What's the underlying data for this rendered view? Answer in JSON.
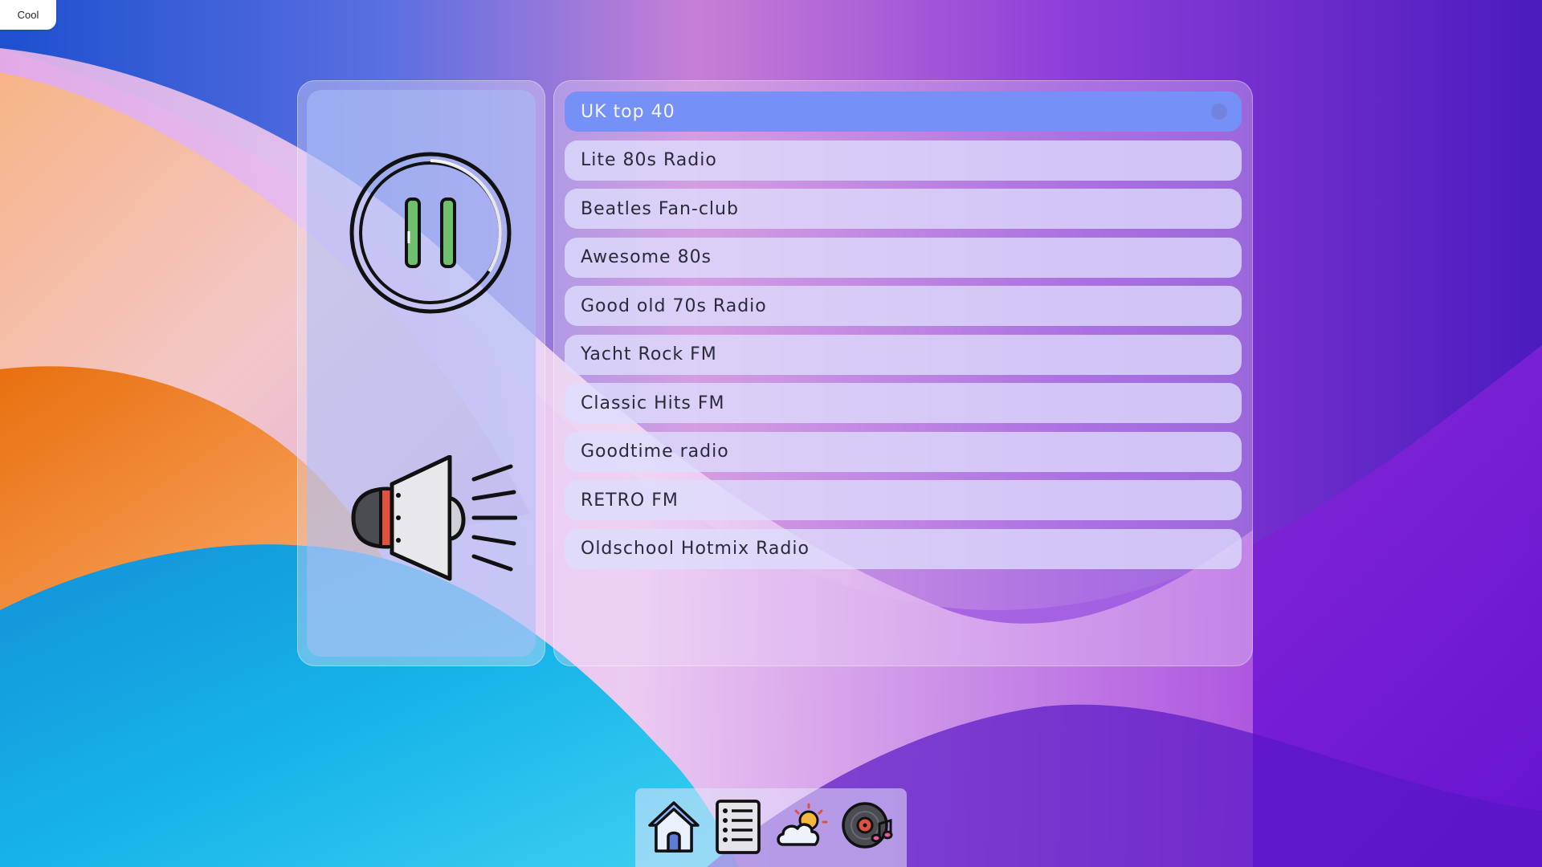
{
  "corner_tab": {
    "label": "Cool"
  },
  "player": {
    "state": "playing",
    "play_pause_icon": "pause-icon",
    "volume_icon": "speaker-icon"
  },
  "stations": {
    "selected_index": 0,
    "items": [
      {
        "label": "UK top 40"
      },
      {
        "label": "Lite 80s Radio"
      },
      {
        "label": "Beatles Fan-club"
      },
      {
        "label": "Awesome 80s"
      },
      {
        "label": "Good old 70s Radio"
      },
      {
        "label": "Yacht Rock FM"
      },
      {
        "label": "Classic Hits FM"
      },
      {
        "label": "Goodtime radio"
      },
      {
        "label": "RETRO FM"
      },
      {
        "label": "Oldschool Hotmix Radio"
      }
    ]
  },
  "dock": {
    "items": [
      {
        "icon": "home-icon"
      },
      {
        "icon": "list-icon"
      },
      {
        "icon": "weather-icon"
      },
      {
        "icon": "music-disc-icon"
      }
    ]
  },
  "colors": {
    "selected_station": "#7590f6",
    "station_row": "#dedefc",
    "accent_green": "#6fbf6f",
    "accent_red": "#e0523f"
  }
}
